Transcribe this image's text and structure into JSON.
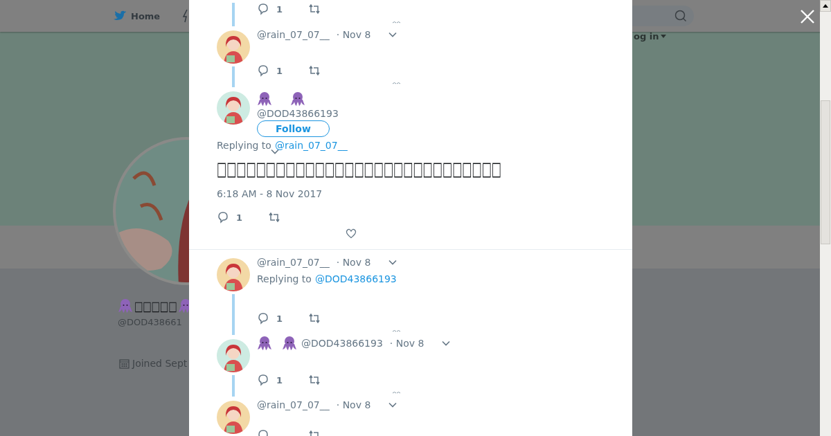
{
  "nav": {
    "home": "Home",
    "log_in": "og in"
  },
  "profile": {
    "name": [
      {
        "kind": "emoji"
      },
      {
        "kind": "text",
        "text": "□□□□□"
      },
      {
        "kind": "emoji"
      }
    ],
    "handle": "@DOD438661",
    "joined": "Joined Sept"
  },
  "thread": [
    {
      "kind": "actions",
      "replies": "1"
    },
    {
      "kind": "compact",
      "color": "#f3d9a6",
      "handle": "@rain_07_07__",
      "date": "· Nov 8",
      "replies": "1"
    },
    {
      "kind": "main",
      "color": "#cdebe2",
      "name": [
        {
          "kind": "emoji"
        },
        {
          "kind": "emoji"
        }
      ],
      "handle": "@DOD43866193",
      "follow": "Follow",
      "replying_label": "Replying to",
      "replying_to": "@rain_07_07__",
      "text": "□□□□□□□□□□□□□□□□□□□□□□□□□□□□□",
      "timestamp": "6:18 AM - 8 Nov 2017",
      "replies": "1"
    },
    {
      "kind": "compact",
      "color": "#f3d9a6",
      "handle": "@rain_07_07__",
      "date": "· Nov 8",
      "replying_label": "Replying to",
      "replying_to": "@DOD43866193",
      "replies": "1"
    },
    {
      "kind": "compact",
      "color": "#cdebe2",
      "name": [
        {
          "kind": "emoji"
        },
        {
          "kind": "emoji"
        }
      ],
      "handle": "@DOD43866193",
      "date": "· Nov 8",
      "replies": "1"
    },
    {
      "kind": "compact",
      "color": "#f3d9a6",
      "handle": "@rain_07_07__",
      "date": "· Nov 8"
    }
  ]
}
